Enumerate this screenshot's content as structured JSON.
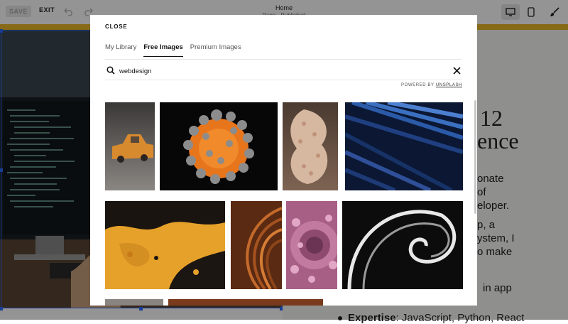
{
  "toolbar": {
    "save_label": "SAVE",
    "exit_label": "EXIT",
    "page_title": "Home",
    "page_status": "Page · Published"
  },
  "background": {
    "heading_line1": "12",
    "heading_line2": "ence",
    "para_lines": [
      "onate",
      "of",
      "eloper.",
      "",
      "p, a",
      "ystem, I",
      "o make",
      "",
      "in app"
    ],
    "bullet_label": "Expertise",
    "bullet_text": ": JavaScript, Python, React"
  },
  "modal": {
    "close_label": "CLOSE",
    "tabs": [
      {
        "label": "My Library",
        "active": false
      },
      {
        "label": "Free Images",
        "active": true
      },
      {
        "label": "Premium Images",
        "active": false
      }
    ],
    "search": {
      "value": "webdesign",
      "placeholder": "Search"
    },
    "powered_by": "POWERED BY",
    "powered_brand": "UNSPLASH",
    "images": [
      {
        "name": "orange-toy-truck"
      },
      {
        "name": "orange-sphere-gray-balls"
      },
      {
        "name": "beaded-spiral-sculpture"
      },
      {
        "name": "blue-geometric-streaks"
      },
      {
        "name": "yellow-black-abstract-waves"
      },
      {
        "name": "copper-curved-layers"
      },
      {
        "name": "pink-lattice-tunnel"
      },
      {
        "name": "white-fractal-spiral"
      }
    ]
  },
  "colors": {
    "accent": "#e8b92c",
    "selection": "#2a6cff"
  }
}
